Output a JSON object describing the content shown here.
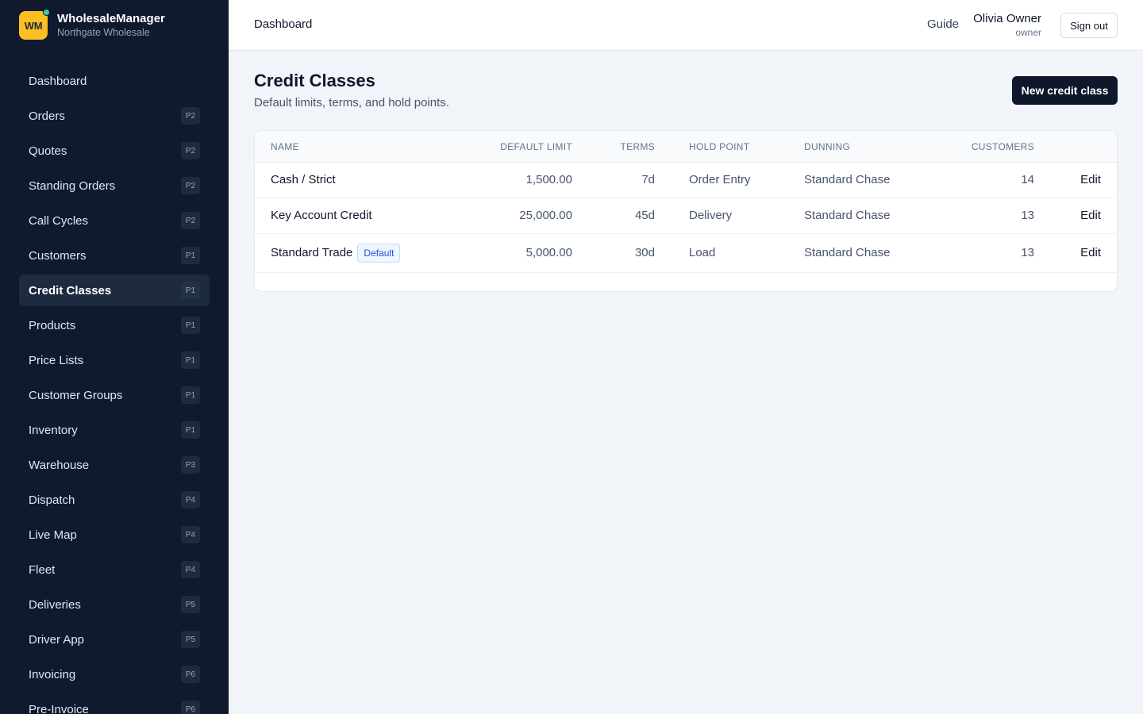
{
  "brand": {
    "logo": "WM",
    "name": "WholesaleManager",
    "company": "Northgate Wholesale"
  },
  "sidebar": {
    "items": [
      {
        "label": "Dashboard",
        "badge": ""
      },
      {
        "label": "Orders",
        "badge": "P2"
      },
      {
        "label": "Quotes",
        "badge": "P2"
      },
      {
        "label": "Standing Orders",
        "badge": "P2"
      },
      {
        "label": "Call Cycles",
        "badge": "P2"
      },
      {
        "label": "Customers",
        "badge": "P1"
      },
      {
        "label": "Credit Classes",
        "badge": "P1",
        "active": true
      },
      {
        "label": "Products",
        "badge": "P1"
      },
      {
        "label": "Price Lists",
        "badge": "P1"
      },
      {
        "label": "Customer Groups",
        "badge": "P1"
      },
      {
        "label": "Inventory",
        "badge": "P1"
      },
      {
        "label": "Warehouse",
        "badge": "P3"
      },
      {
        "label": "Dispatch",
        "badge": "P4"
      },
      {
        "label": "Live Map",
        "badge": "P4"
      },
      {
        "label": "Fleet",
        "badge": "P4"
      },
      {
        "label": "Deliveries",
        "badge": "P5"
      },
      {
        "label": "Driver App",
        "badge": "P5"
      },
      {
        "label": "Invoicing",
        "badge": "P6"
      },
      {
        "label": "Pre-Invoice",
        "badge": "P6"
      }
    ]
  },
  "topbar": {
    "breadcrumb": "Dashboard",
    "guide": "Guide",
    "user_name": "Olivia Owner",
    "user_role": "owner",
    "sign_out": "Sign out"
  },
  "main": {
    "title": "Credit Classes",
    "subtitle": "Default limits, terms, and hold points.",
    "new_button": "New credit class",
    "columns": [
      "Name",
      "Default Limit",
      "Terms",
      "Hold Point",
      "Dunning",
      "Customers"
    ],
    "rows": [
      {
        "name": "Cash / Strict",
        "limit": "1,500.00",
        "terms": "7d",
        "hold": "Order Entry",
        "dunning": "Standard Chase",
        "customers": "14",
        "action": "Edit",
        "badge": ""
      },
      {
        "name": "Key Account Credit",
        "limit": "25,000.00",
        "terms": "45d",
        "hold": "Delivery",
        "dunning": "Standard Chase",
        "customers": "13",
        "action": "Edit",
        "badge": ""
      },
      {
        "name": "Standard Trade",
        "limit": "5,000.00",
        "terms": "30d",
        "hold": "Load",
        "dunning": "Standard Chase",
        "customers": "13",
        "action": "Edit",
        "badge": "Default"
      }
    ]
  },
  "colors": {
    "sidebar_bg": "#0f1a2e",
    "accent_logo": "#fbbf24",
    "status_dot": "#34d399",
    "primary_button": "#0f172a",
    "default_badge": "#1d4ed8"
  }
}
